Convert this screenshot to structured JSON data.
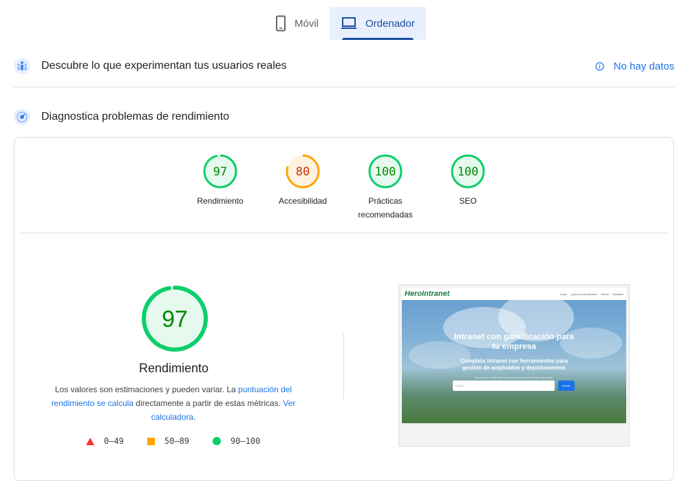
{
  "tabs": [
    {
      "label": "Móvil",
      "icon": "mobile-icon",
      "active": false
    },
    {
      "label": "Ordenador",
      "icon": "laptop-icon",
      "active": true
    }
  ],
  "field_data": {
    "title": "Descubre lo que experimentan tus usuarios reales",
    "status": "No hay datos",
    "icon": "users-icon"
  },
  "lab_data": {
    "title": "Diagnostica problemas de rendimiento",
    "icon": "speedometer-icon"
  },
  "gauges": [
    {
      "score": 97,
      "label": "Rendimiento",
      "color": "#0cce6b",
      "text_color": "#008800",
      "fill": "#e6f9ee"
    },
    {
      "score": 80,
      "label": "Accesibilidad",
      "color": "#ffa400",
      "text_color": "#c33300",
      "fill": "#fff3e0"
    },
    {
      "score": 100,
      "label": "Prácticas recomendadas",
      "color": "#0cce6b",
      "text_color": "#008800",
      "fill": "#e6f9ee"
    },
    {
      "score": 100,
      "label": "SEO",
      "color": "#0cce6b",
      "text_color": "#008800",
      "fill": "#e6f9ee"
    }
  ],
  "performance": {
    "score": 97,
    "title": "Rendimiento",
    "desc_1": "Los valores son estimaciones y pueden variar. La ",
    "link_1": "puntuación del rendimiento se calcula",
    "desc_2": " directamente a partir de estas métricas. ",
    "link_2": "Ver calculadora",
    "desc_3": "."
  },
  "legend": [
    {
      "range": "0–49",
      "shape": "triangle",
      "color": "#ff3333"
    },
    {
      "range": "50–89",
      "shape": "square",
      "color": "#ffa400"
    },
    {
      "range": "90–100",
      "shape": "circle",
      "color": "#0cce6b"
    }
  ],
  "screenshot": {
    "logo": "HeroIntranet",
    "nav_links": [
      "Inicio",
      "¿Qué es una Intranet?",
      "Precio",
      "Contacto"
    ],
    "headline": "Intranet con gamificación para tu empresa",
    "subheadline": "Completa intranet con herramientas para gestión de empleados y departamentos",
    "small_text": "Apúntate y recibe información exclusiva cuando esté disponible",
    "email_placeholder": "E-Mail",
    "button_label": "Enviar"
  }
}
